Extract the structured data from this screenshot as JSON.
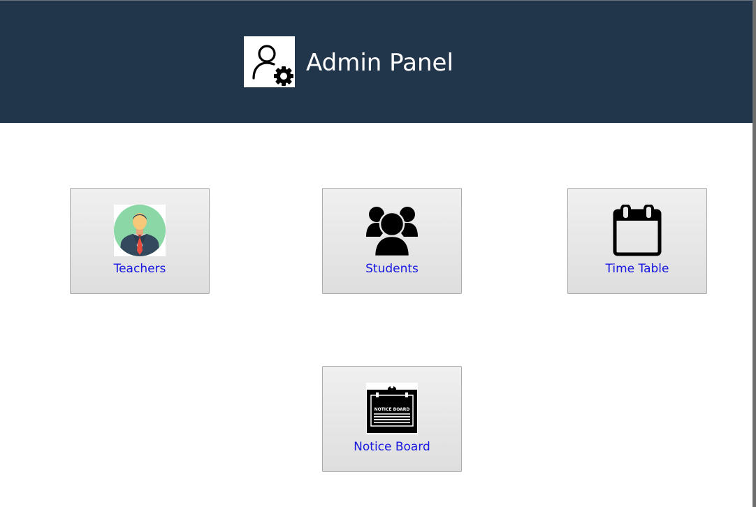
{
  "header": {
    "title": "Admin Panel",
    "logo_icon": "admin-settings-icon",
    "background_color": "#21354b"
  },
  "tiles": [
    {
      "label": "Teachers",
      "icon": "teacher-icon"
    },
    {
      "label": "Students",
      "icon": "students-group-icon"
    },
    {
      "label": "Time Table",
      "icon": "calendar-icon"
    },
    {
      "label": "Notice Board",
      "icon": "notice-board-icon",
      "icon_text": "NOTICE BOARD"
    }
  ],
  "colors": {
    "link_text": "#1717e0",
    "tile_gradient_top": "#f0f0f0",
    "tile_gradient_bottom": "#dedede"
  }
}
